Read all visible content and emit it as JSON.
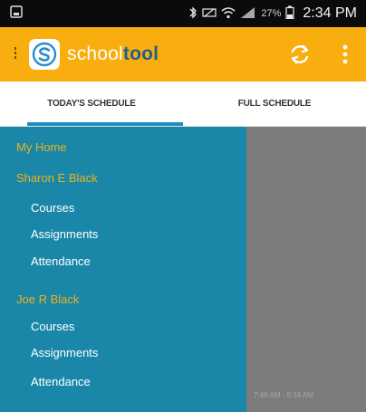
{
  "status_bar": {
    "battery": "27%",
    "time": "2:34 PM"
  },
  "app_bar": {
    "title_light": "school",
    "title_bold": "tool"
  },
  "tabs": [
    {
      "label": "TODAY'S SCHEDULE",
      "active": true
    },
    {
      "label": "FULL SCHEDULE",
      "active": false
    }
  ],
  "drawer": {
    "home": "My Home",
    "students": [
      {
        "name": "Sharon E Black",
        "items": [
          "Courses",
          "Assignments",
          "Attendance"
        ]
      },
      {
        "name": "Joe R Black",
        "items": [
          "Courses",
          "Assignments",
          "Attendance"
        ]
      }
    ]
  },
  "content": {
    "time_range": "7:48 AM - 8:34 AM"
  },
  "colors": {
    "app_bar": "#f8ae0e",
    "drawer": "#1a87a9",
    "drawer_section_text": "#e9b21e",
    "logo_blue": "#1f5f8f",
    "tab_indicator": "#1f8fc1",
    "overlay": "#7c7c7c"
  },
  "icons": {
    "logo": "schooltool-logo-icon",
    "sync": "sync-icon",
    "menu": "overflow-menu-icon"
  }
}
